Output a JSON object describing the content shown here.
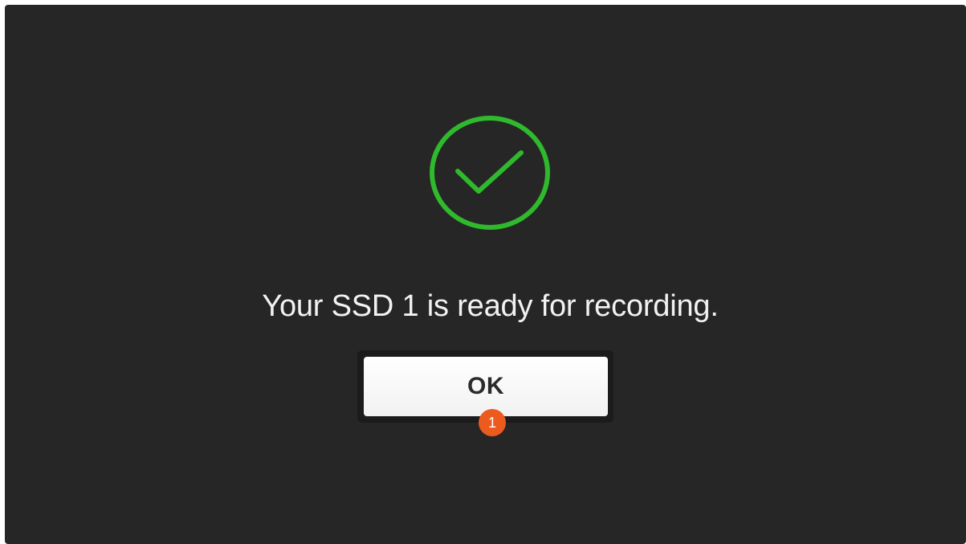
{
  "dialog": {
    "message": "Your SSD 1 is ready for recording.",
    "ok_label": "OK",
    "status_icon": "checkmark-circle-icon",
    "status_color": "#2fb92c"
  },
  "annotation": {
    "step_number": "1",
    "badge_color": "#ec5a1e"
  },
  "colors": {
    "background": "#262626",
    "text": "#f2f2f2",
    "button": "#ffffff"
  }
}
